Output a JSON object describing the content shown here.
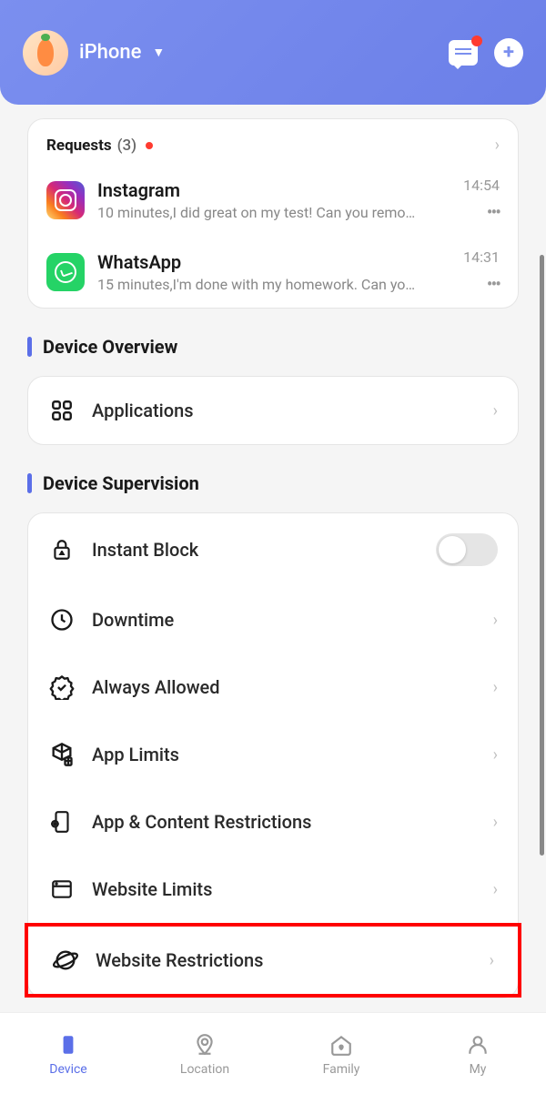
{
  "header": {
    "device_name": "iPhone"
  },
  "requests": {
    "title": "Requests",
    "count": "(3)",
    "items": [
      {
        "name": "Instagram",
        "message": "10 minutes,I did great on my test! Can you remo…",
        "time": "14:54"
      },
      {
        "name": "WhatsApp",
        "message": "15 minutes,I'm done with my homework. Can yo…",
        "time": "14:31"
      }
    ]
  },
  "overview": {
    "title": "Device Overview",
    "applications": "Applications"
  },
  "supervision": {
    "title": "Device Supervision",
    "items": {
      "instant_block": "Instant Block",
      "downtime": "Downtime",
      "always_allowed": "Always Allowed",
      "app_limits": "App Limits",
      "app_content": "App & Content Restrictions",
      "website_limits": "Website Limits",
      "website_restrictions": "Website Restrictions"
    }
  },
  "nav": {
    "device": "Device",
    "location": "Location",
    "family": "Family",
    "my": "My"
  }
}
